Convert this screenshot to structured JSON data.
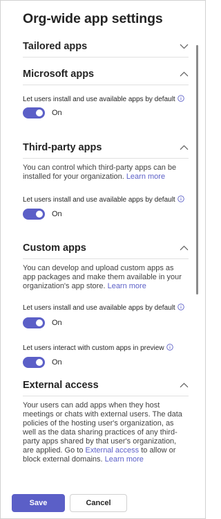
{
  "panel": {
    "title": "Org-wide app settings"
  },
  "sections": {
    "tailored": {
      "title": "Tailored apps",
      "expanded": false
    },
    "microsoft": {
      "title": "Microsoft apps",
      "expanded": true,
      "setting_label": "Let users install and use available apps by default",
      "toggle_state": "On"
    },
    "third_party": {
      "title": "Third-party apps",
      "expanded": true,
      "description_lines": [
        "You can control which third-party apps can be",
        "installed for your organization."
      ],
      "learn_more": "Learn more",
      "setting_label": "Let users install and use available apps by default",
      "toggle_state": "On"
    },
    "custom": {
      "title": "Custom apps",
      "expanded": true,
      "description_lines": [
        "You can develop and upload custom apps as",
        "app packages and make them available in your",
        "organization's app store."
      ],
      "learn_more": "Learn more",
      "setting_label": "Let users install and use available apps by default",
      "toggle_state": "On",
      "preview_label": "Let users interact with custom apps in preview",
      "preview_toggle_state": "On"
    },
    "external": {
      "title": "External access",
      "expanded": true,
      "description_lines": [
        "Your users can add apps when they host",
        "meetings or chats with external users. The data",
        "policies of the hosting user's organization, as",
        "well as the data sharing practices of any third-",
        "party apps shared by that user's organization,",
        "are applied. Go to",
        "to allow or",
        "block external domains."
      ],
      "external_access_link": "External access",
      "learn_more": "Learn more"
    }
  },
  "footer": {
    "save_label": "Save",
    "cancel_label": "Cancel"
  },
  "colors": {
    "accent": "#5b5fc7",
    "text": "#242424",
    "divider": "#e0e0e0"
  },
  "icons": {
    "chevron_down": "chevron-down-icon",
    "chevron_up": "chevron-up-icon",
    "info": "info-icon"
  }
}
